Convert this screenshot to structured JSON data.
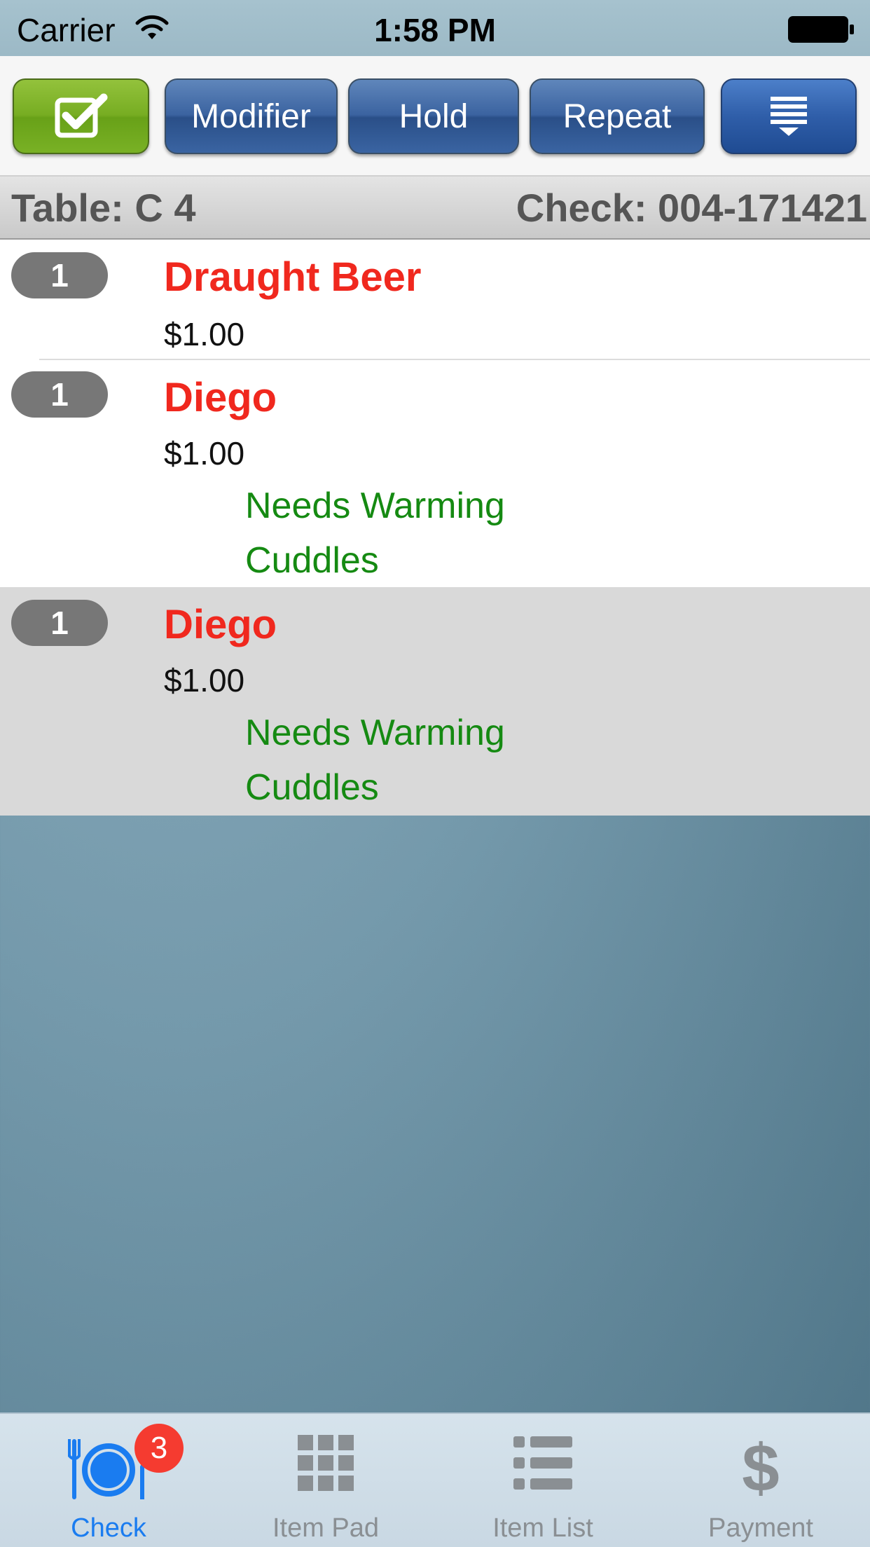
{
  "status_bar": {
    "carrier": "Carrier",
    "time": "1:58 PM",
    "wifi_icon": "wifi-icon",
    "battery_icon": "battery-icon"
  },
  "toolbar": {
    "confirm_icon": "checkbox-icon",
    "modifier_label": "Modifier",
    "hold_label": "Hold",
    "repeat_label": "Repeat",
    "menu_icon": "menu-list-icon"
  },
  "header": {
    "table_label": "Table: C 4",
    "check_label": "Check: 004-171421"
  },
  "items": [
    {
      "qty": "1",
      "name": "Draught Beer",
      "price": "$1.00",
      "modifiers": []
    },
    {
      "qty": "1",
      "name": "Diego",
      "price": "$1.00",
      "modifiers": [
        "Needs Warming",
        "Cuddles"
      ]
    },
    {
      "qty": "1",
      "name": "Diego",
      "price": "$1.00",
      "modifiers": [
        "Needs Warming",
        "Cuddles"
      ]
    }
  ],
  "tabs": [
    {
      "label": "Check",
      "icon": "plate-cutlery-icon",
      "badge": "3",
      "active": true
    },
    {
      "label": "Item Pad",
      "icon": "grid-icon"
    },
    {
      "label": "Item List",
      "icon": "list-icon"
    },
    {
      "label": "Payment",
      "icon": "dollar-icon"
    }
  ],
  "colors": {
    "item_name": "#f0281e",
    "modifier": "#158a12",
    "active_tab": "#1a7cf0",
    "badge": "#f53b30",
    "confirm_button": "#77ad22",
    "toolbar_button": "#3b63a0"
  }
}
